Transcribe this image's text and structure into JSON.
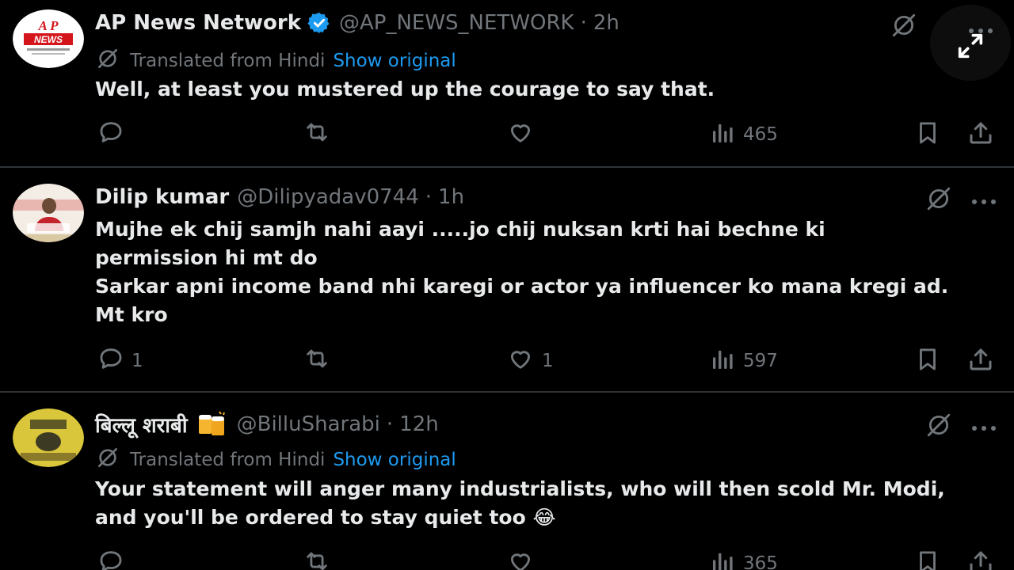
{
  "tweets": [
    {
      "name": "AP News Network",
      "handle": "@AP_NEWS_NETWORK",
      "time": "2h",
      "verified": true,
      "translated_label": "Translated from Hindi",
      "show_original": "Show original",
      "lines": [
        "Well, at least you mustered up the courage to say that."
      ],
      "reply_count": "",
      "retweet_count": "",
      "like_count": "",
      "views": "465"
    },
    {
      "name": "Dilip kumar",
      "handle": "@Dilipyadav0744",
      "time": "1h",
      "verified": false,
      "lines": [
        "Mujhe ek chij samjh nahi aayi  .....jo chij nuksan krti hai bechne ki",
        "permission hi mt do",
        "Sarkar apni income band nhi karegi or actor ya influencer ko mana kregi ad.",
        "Mt kro"
      ],
      "reply_count": "1",
      "retweet_count": "",
      "like_count": "1",
      "views": "597"
    },
    {
      "name": "बिल्लू शराबी",
      "handle": "@BilluSharabi",
      "time": "12h",
      "verified": false,
      "translated_label": "Translated from Hindi",
      "show_original": "Show original",
      "lines": [
        "Your statement will anger many industrialists, who will then scold Mr. Modi,",
        "and you'll be ordered to stay quiet too 😂"
      ],
      "reply_count": "",
      "retweet_count": "",
      "like_count": "",
      "views": "365"
    }
  ],
  "avatar_text": {
    "ap_logo_top": "A P",
    "ap_logo_main": "NEWS"
  },
  "separator": "·",
  "colors": {
    "background": "#000000",
    "text": "#e7e9ea",
    "muted": "#71767b",
    "link": "#1d9bf0",
    "verified": "#1d9bf0",
    "divider": "#2f3336"
  },
  "icons": [
    "grok-slash-icon",
    "more-icon",
    "expand-icon",
    "reply-icon",
    "retweet-icon",
    "like-icon",
    "views-icon",
    "bookmark-icon",
    "share-icon",
    "verified-badge-icon",
    "translate-icon"
  ]
}
